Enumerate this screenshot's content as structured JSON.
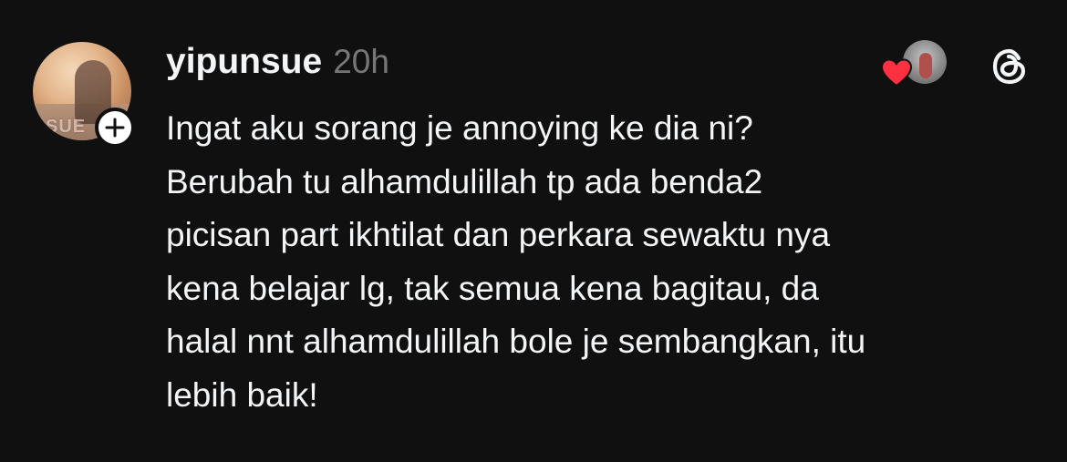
{
  "post": {
    "username": "yipunsue",
    "time": "20h",
    "avatar_watermark": "SUE",
    "text": "Ingat aku sorang je annoying ke dia ni?\nBerubah tu alhamdulillah tp ada benda2\npicisan part ikhtilat dan perkara sewaktu nya\nkena belajar lg, tak semua kena bagitau, da\nhalal nnt alhamdulillah bole je sembangkan, itu\nlebih baik!"
  },
  "icons": {
    "follow": "plus-icon",
    "like": "heart-icon",
    "app": "threads-logo-icon"
  },
  "colors": {
    "background": "#101010",
    "text": "#f3f5f7",
    "muted": "#777777",
    "heart": "#ff3040"
  }
}
